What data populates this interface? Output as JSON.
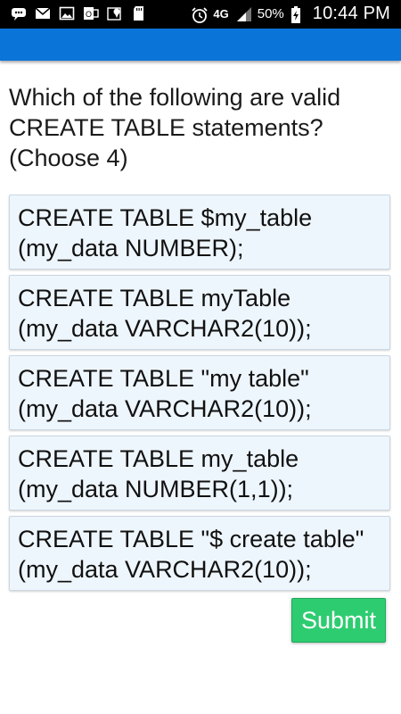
{
  "status_bar": {
    "battery_percent": "50%",
    "network": "4G",
    "time": "10:44 PM"
  },
  "question": {
    "text": "Which of the following are valid CREATE TABLE statements? (Choose 4)"
  },
  "options": [
    {
      "line1": "CREATE TABLE $my_table",
      "line2": "(my_data NUMBER);"
    },
    {
      "line1": "CREATE TABLE myTable",
      "line2": "(my_data VARCHAR2(10));"
    },
    {
      "line1": "CREATE TABLE \"my table\"",
      "line2": "(my_data VARCHAR2(10));"
    },
    {
      "line1": "CREATE TABLE my_table",
      "line2": "(my_data NUMBER(1,1));"
    },
    {
      "line1": "CREATE TABLE \"$ create table\"",
      "line2": "(my_data VARCHAR2(10));"
    }
  ],
  "submit_label": "Submit",
  "colors": {
    "app_bar": "#0a74d9",
    "option_bg": "#eef6fd",
    "submit_bg": "#2ecc71"
  }
}
